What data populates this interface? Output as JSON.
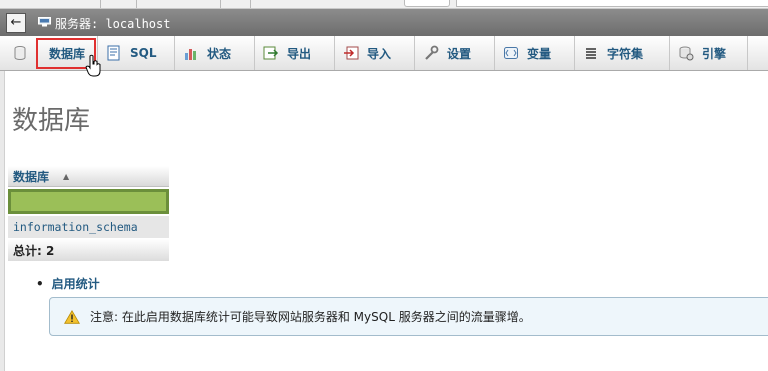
{
  "server": {
    "back_label": "←",
    "label": "服务器: localhost"
  },
  "tabs": [
    {
      "id": "databases",
      "label": "数据库",
      "icon": "database-icon"
    },
    {
      "id": "sql",
      "label": "SQL",
      "icon": "sql-icon"
    },
    {
      "id": "status",
      "label": "状态",
      "icon": "status-icon"
    },
    {
      "id": "export",
      "label": "导出",
      "icon": "export-icon"
    },
    {
      "id": "import",
      "label": "导入",
      "icon": "import-icon"
    },
    {
      "id": "settings",
      "label": "设置",
      "icon": "wrench-icon"
    },
    {
      "id": "variables",
      "label": "变量",
      "icon": "variables-icon"
    },
    {
      "id": "charsets",
      "label": "字符集",
      "icon": "charset-icon"
    },
    {
      "id": "engines",
      "label": "引擎",
      "icon": "engine-icon"
    }
  ],
  "page": {
    "title": "数据库"
  },
  "db_table": {
    "header": "数据库",
    "sort_indicator": "▲",
    "rows": [
      "information_schema"
    ],
    "total_label": "总计: 2"
  },
  "stats": {
    "bullet": "•",
    "link_label": "启用统计"
  },
  "notice": {
    "text": "注意: 在此启用数据库统计可能导致网站服务器和 MySQL 服务器之间的流量骤增。"
  },
  "colors": {
    "link": "#235a81",
    "highlight_green": "#9bbf58",
    "active_outline": "#e03030"
  }
}
